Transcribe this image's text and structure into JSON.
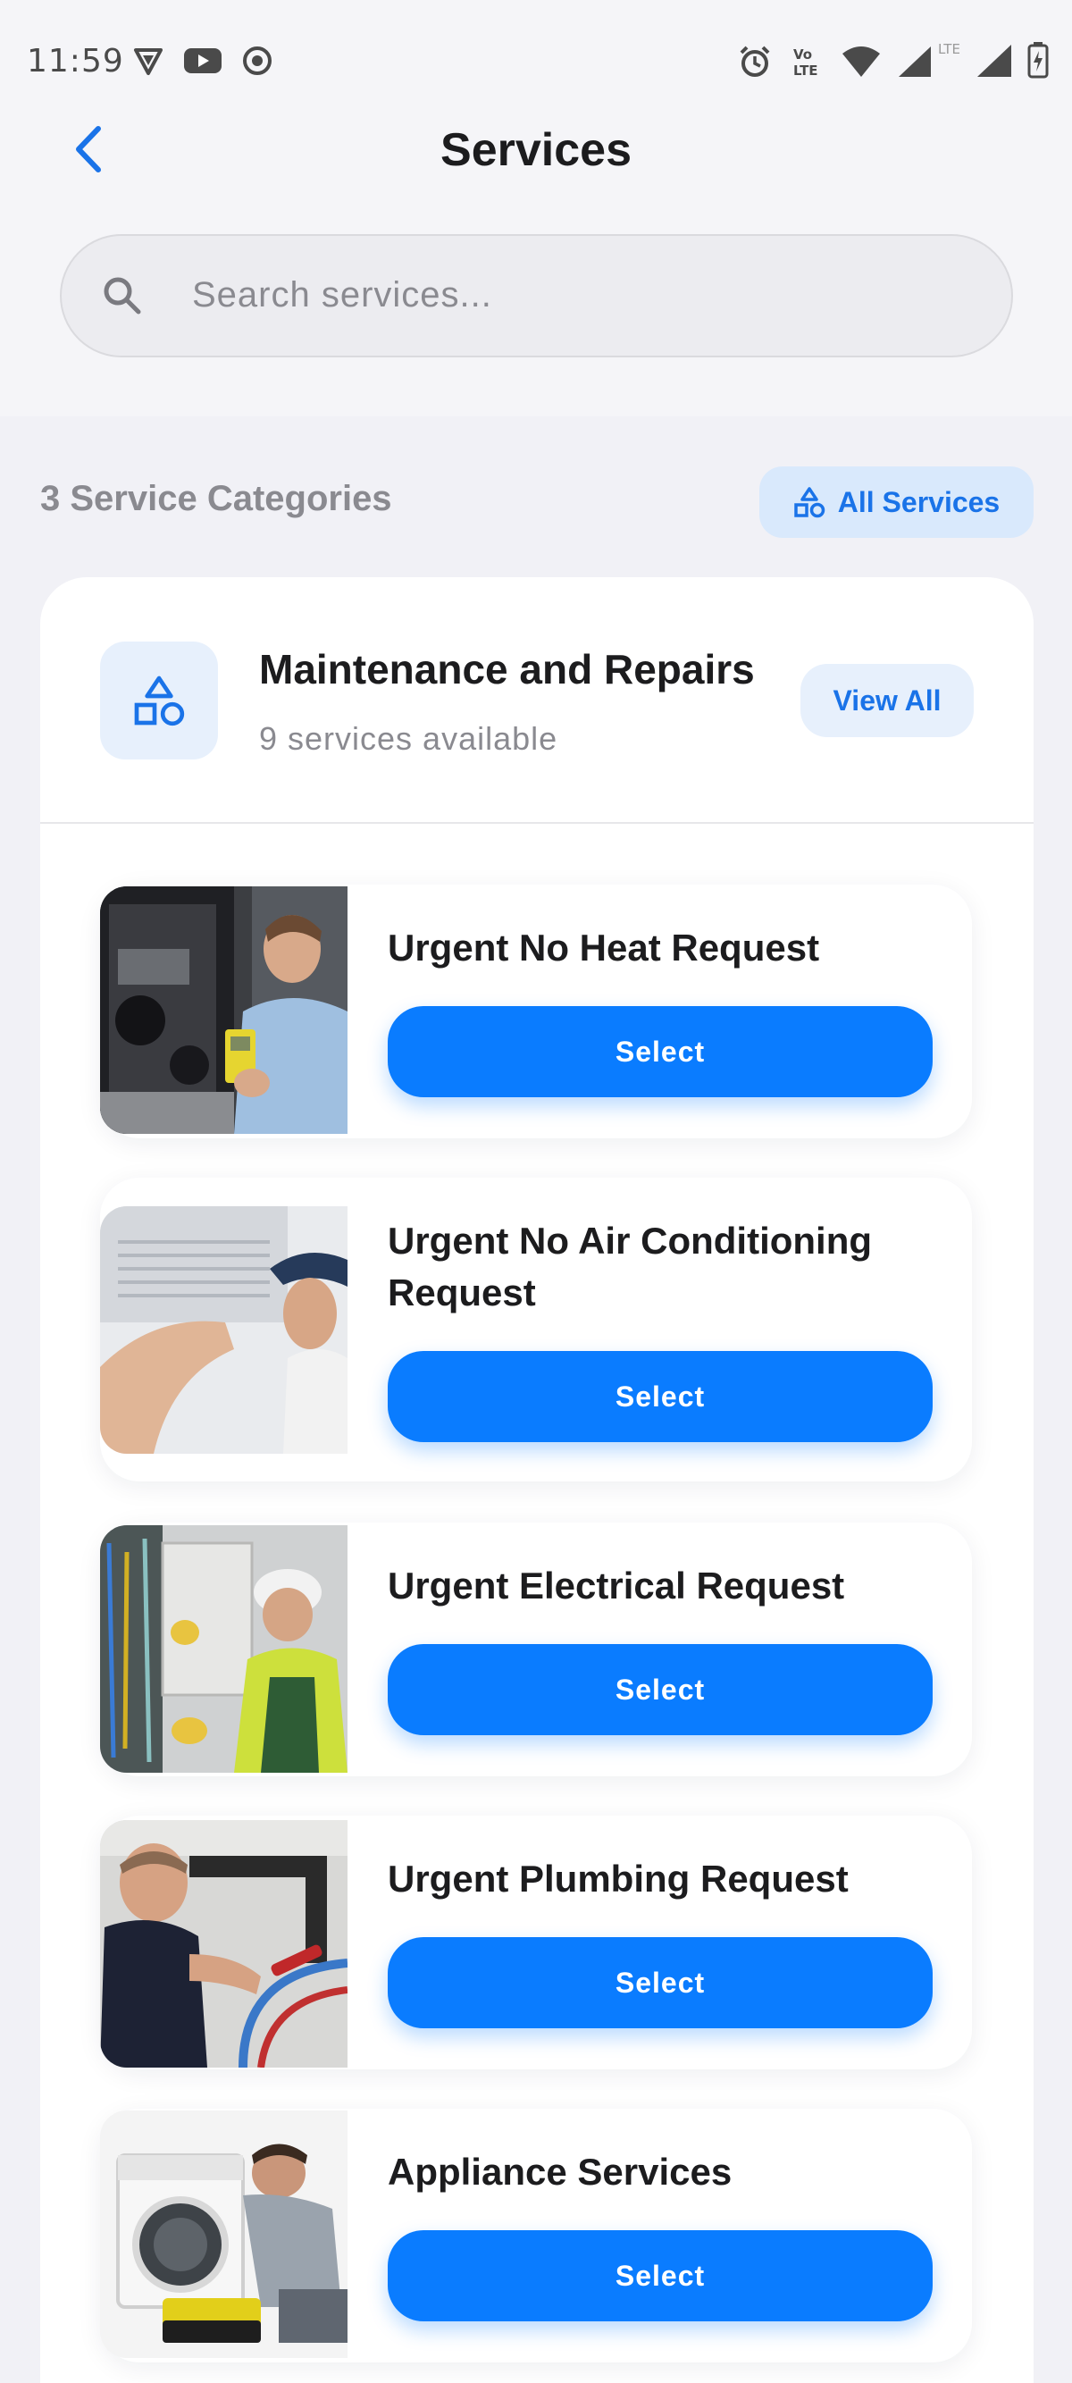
{
  "status_bar": {
    "time": "11:59",
    "left_icons": [
      "vpn-icon",
      "youtube-icon",
      "screen-record-icon"
    ],
    "right_icons": [
      "alarm-icon",
      "volte-icon",
      "wifi-icon",
      "signal-icon",
      "lte-signal-icon",
      "battery-icon"
    ]
  },
  "header": {
    "title": "Services"
  },
  "search": {
    "placeholder": "Search services..."
  },
  "categories": {
    "count_label": "3 Service Categories",
    "all_services_label": "All Services"
  },
  "category": {
    "title": "Maintenance and Repairs",
    "subtitle": "9 services available",
    "view_all_label": "View All"
  },
  "services": [
    {
      "name": "Urgent No Heat Request",
      "button": "Select"
    },
    {
      "name": "Urgent No Air Conditioning Request",
      "button": "Select"
    },
    {
      "name": "Urgent Electrical Request",
      "button": "Select"
    },
    {
      "name": "Urgent Plumbing Request",
      "button": "Select"
    },
    {
      "name": "Appliance Services",
      "button": "Select"
    }
  ],
  "colors": {
    "accent": "#0a7cff",
    "accent_light": "#e7f0fc",
    "background": "#f1f1f6"
  }
}
